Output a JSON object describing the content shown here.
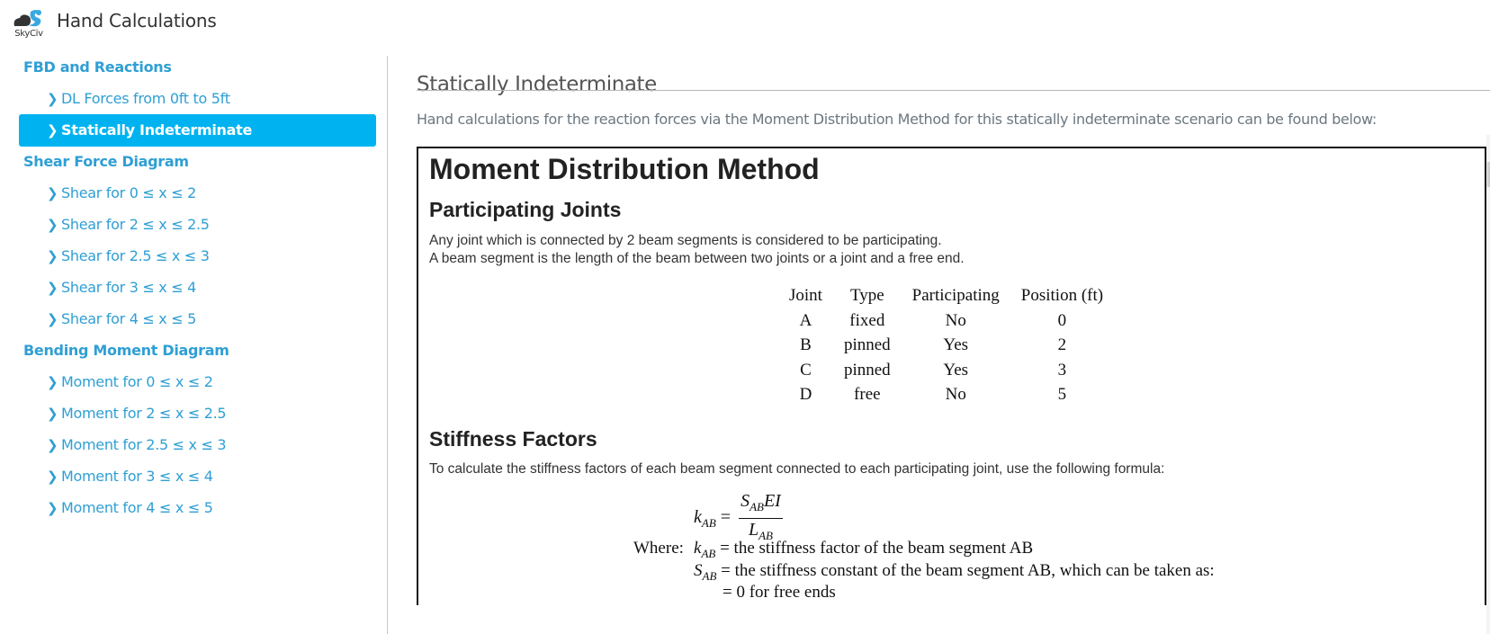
{
  "header": {
    "logo_text": "SkyCiv",
    "app_title": "Hand Calculations"
  },
  "sidebar": {
    "items": [
      {
        "label": "FBD and Reactions",
        "type": "section"
      },
      {
        "label": "DL Forces from 0ft to 5ft",
        "type": "sub"
      },
      {
        "label": "Statically Indeterminate",
        "type": "sub",
        "active": true
      },
      {
        "label": "Shear Force Diagram",
        "type": "section"
      },
      {
        "label": "Shear for 0 ≤ x ≤ 2",
        "type": "sub"
      },
      {
        "label": "Shear for 2 ≤ x ≤ 2.5",
        "type": "sub"
      },
      {
        "label": "Shear for 2.5 ≤ x ≤ 3",
        "type": "sub"
      },
      {
        "label": "Shear for 3 ≤ x ≤ 4",
        "type": "sub"
      },
      {
        "label": "Shear for 4 ≤ x ≤ 5",
        "type": "sub"
      },
      {
        "label": "Bending Moment Diagram",
        "type": "section"
      },
      {
        "label": "Moment for 0 ≤ x ≤ 2",
        "type": "sub"
      },
      {
        "label": "Moment for 2 ≤ x ≤ 2.5",
        "type": "sub"
      },
      {
        "label": "Moment for 2.5 ≤ x ≤ 3",
        "type": "sub"
      },
      {
        "label": "Moment for 3 ≤ x ≤ 4",
        "type": "sub"
      },
      {
        "label": "Moment for 4 ≤ x ≤ 5",
        "type": "sub"
      }
    ],
    "chevron_icon": "❯"
  },
  "main": {
    "title": "Statically Indeterminate",
    "intro": "Hand calculations for the reaction forces via the Moment Distribution Method for this statically indeterminate scenario can be found below:"
  },
  "document": {
    "heading": "Moment Distribution Method",
    "participating": {
      "heading": "Participating Joints",
      "line1": "Any joint which is connected by 2 beam segments is considered to be participating.",
      "line2": "A beam segment is the length of the beam between two joints or a joint and a free end.",
      "table": {
        "headers": [
          "Joint",
          "Type",
          "Participating",
          "Position (ft)"
        ],
        "rows": [
          [
            "A",
            "fixed",
            "No",
            "0"
          ],
          [
            "B",
            "pinned",
            "Yes",
            "2"
          ],
          [
            "C",
            "pinned",
            "Yes",
            "3"
          ],
          [
            "D",
            "free",
            "No",
            "5"
          ]
        ]
      }
    },
    "stiffness": {
      "heading": "Stiffness Factors",
      "intro": "To calculate the stiffness factors of each beam segment connected to each participating joint, use the following formula:",
      "formula": {
        "lhs_var": "k",
        "lhs_sub": "AB",
        "num_var": "S",
        "num_sub": "AB",
        "num_rest": "EI",
        "den_var": "L",
        "den_sub": "AB"
      },
      "where_label": "Where:",
      "where_lines": [
        {
          "var": "k",
          "sub": "AB",
          "text": "= the stiffness factor of the beam segment AB"
        },
        {
          "var": "S",
          "sub": "AB",
          "text": "= the stiffness constant of the beam segment AB, which can be taken as:"
        },
        {
          "var": "",
          "sub": "",
          "text": "= 0 for free ends"
        }
      ]
    }
  }
}
